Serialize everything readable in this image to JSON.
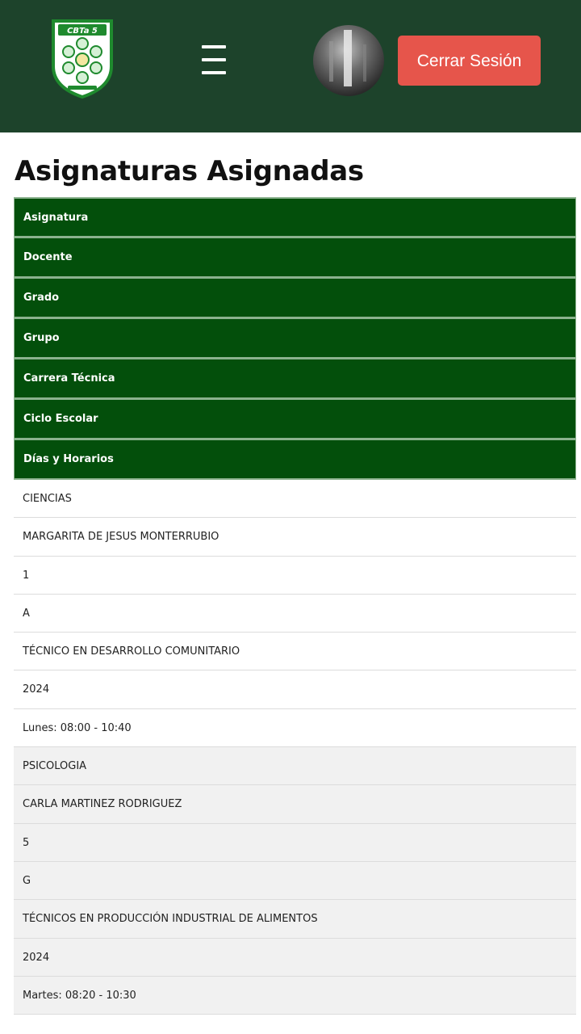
{
  "header": {
    "logo_text": "CBTa 5",
    "logout_label": "Cerrar Sesión",
    "menu_glyph": "☰"
  },
  "colors": {
    "topbar": "#1d432b",
    "table_header": "#034f0b",
    "logout": "#e6554b",
    "logo_green": "#1f8a2e"
  },
  "main": {
    "title": "Asignaturas Asignadas",
    "columns": [
      "Asignatura",
      "Docente",
      "Grado",
      "Grupo",
      "Carrera Técnica",
      "Ciclo Escolar",
      "Días y Horarios"
    ],
    "records": [
      {
        "asignatura": "CIENCIAS",
        "docente": "MARGARITA DE JESUS MONTERRUBIO",
        "grado": "1",
        "grupo": "A",
        "carrera": "TÉCNICO EN DESARROLLO COMUNITARIO",
        "ciclo": "2024",
        "horario": "Lunes: 08:00 - 10:40"
      },
      {
        "asignatura": "PSICOLOGIA",
        "docente": "CARLA MARTINEZ RODRIGUEZ",
        "grado": "5",
        "grupo": "G",
        "carrera": "TÉCNICOS EN PRODUCCIÓN INDUSTRIAL DE ALIMENTOS",
        "ciclo": "2024",
        "horario": "Martes: 08:20 - 10:30"
      }
    ]
  }
}
